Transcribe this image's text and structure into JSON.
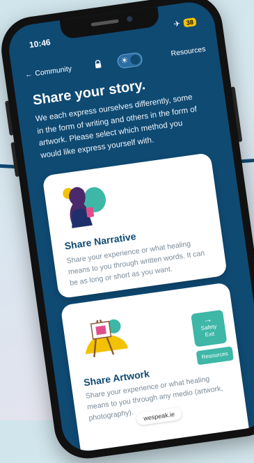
{
  "status_bar": {
    "time": "10:46",
    "battery": "38",
    "airplane_icon": "airplane-icon"
  },
  "topbar": {
    "back_label": "Community",
    "resources_label": "Resources",
    "theme_toggle_on": true
  },
  "intro": {
    "heading": "Share your story.",
    "text": "We each express ourselves differently, some in the form of writing and others in the form of artwork. Please select which method you would like express yourself with."
  },
  "cards": [
    {
      "title": "Share Narrative",
      "description": "Share your experience or what healing means to you through written words. It can be as long or short as you want."
    },
    {
      "title": "Share Artwork",
      "description": "Share your experience or what healing means to you through any medio (artwork, photography)."
    }
  ],
  "floating": {
    "safety_exit_arrow": "→",
    "safety_exit_line1": "Safety",
    "safety_exit_line2": "Exit",
    "resources_label": "Resources"
  },
  "browser": {
    "url": "wespeak.ie"
  },
  "colors": {
    "primary": "#0f4a73",
    "accent": "#3eb7a7",
    "card_bg": "#ffffff",
    "muted_text": "#7a8a98",
    "battery": "#f2c200"
  }
}
